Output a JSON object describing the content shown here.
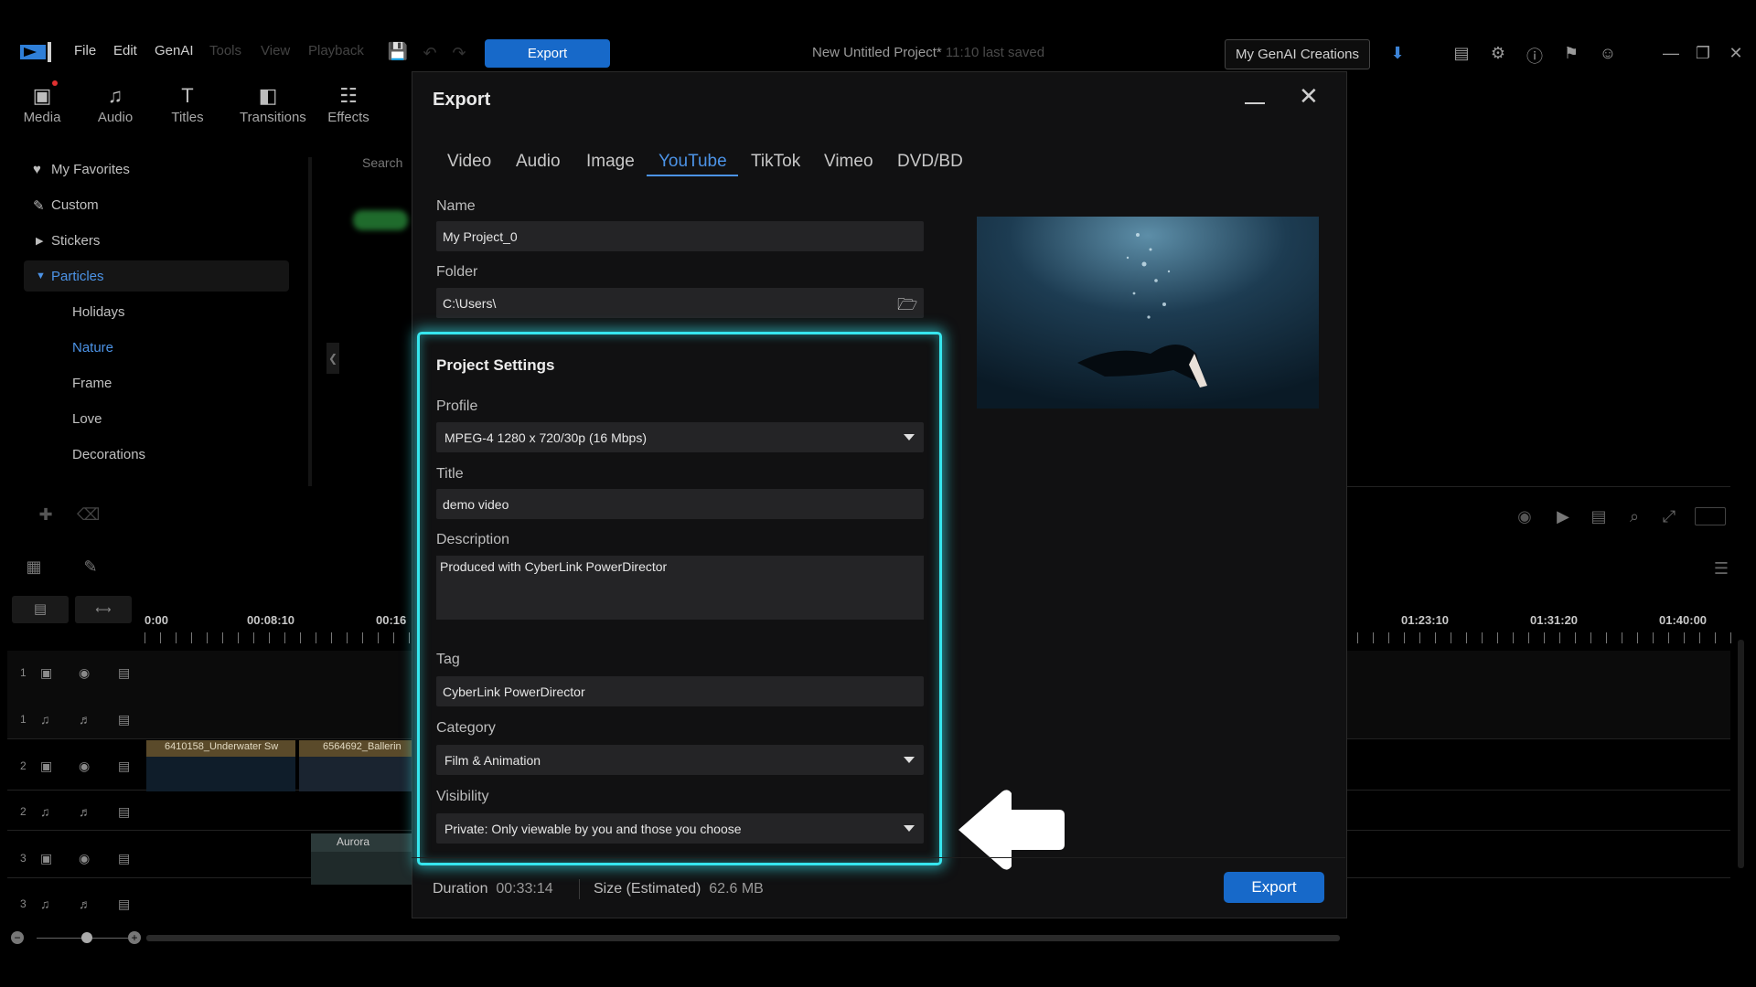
{
  "menu": {
    "file": "File",
    "edit": "Edit",
    "genai": "GenAI",
    "tools": "Tools",
    "view": "View",
    "playback": "Playback",
    "export_label": "Export"
  },
  "project": {
    "name": "New Untitled Project*",
    "saved": "11:10 last saved"
  },
  "header": {
    "genai_creations": "My GenAI Creations"
  },
  "library_tabs": [
    "Media",
    "Audio",
    "Titles",
    "Transitions",
    "Effects"
  ],
  "search_placeholder": "Search",
  "sidebar": {
    "favorites": "My Favorites",
    "custom": "Custom",
    "stickers": "Stickers",
    "particles": "Particles",
    "sub": [
      "Holidays",
      "Nature",
      "Frame",
      "Love",
      "Decorations"
    ]
  },
  "timeline": {
    "ruler": [
      "0:00",
      "00:08:10",
      "00:16",
      "01:23:10",
      "01:31:20",
      "01:40:00"
    ],
    "tracks": [
      "1",
      "1",
      "2",
      "2",
      "3",
      "3"
    ],
    "clips": [
      "6410158_Underwater Sw",
      "6564692_Ballerin",
      "Aurora"
    ]
  },
  "dialog": {
    "title": "Export",
    "tabs": [
      "Video",
      "Audio",
      "Image",
      "YouTube",
      "TikTok",
      "Vimeo",
      "DVD/BD"
    ],
    "active_tab": "YouTube",
    "name_label": "Name",
    "name_value": "My Project_0",
    "folder_label": "Folder",
    "folder_value": "C:\\Users\\",
    "settings_title": "Project Settings",
    "profile_label": "Profile",
    "profile_value": "MPEG-4 1280 x 720/30p (16 Mbps)",
    "title_label": "Title",
    "title_value": "demo video",
    "description_label": "Description",
    "description_value": "Produced with CyberLink PowerDirector",
    "tag_label": "Tag",
    "tag_value": "CyberLink PowerDirector",
    "category_label": "Category",
    "category_value": "Film & Animation",
    "visibility_label": "Visibility",
    "visibility_value": "Private: Only viewable by you and those you choose",
    "duration_label": "Duration",
    "duration_value": "00:33:14",
    "size_label": "Size (Estimated)",
    "size_value": "62.6 MB",
    "export_button": "Export"
  },
  "colors": {
    "accent": "#1769c9",
    "highlight": "#36e6ee",
    "active_text": "#4c93e6"
  }
}
